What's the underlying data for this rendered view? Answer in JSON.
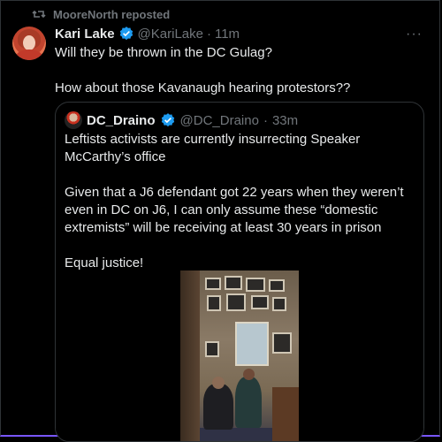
{
  "repost": {
    "label": "MooreNorth reposted"
  },
  "tweet": {
    "author_name": "Kari Lake",
    "handle": "@KariLake",
    "separator": "·",
    "time": "11m",
    "more": "···",
    "text_line1": "Will they be thrown in the DC Gulag?",
    "text_line2": "How about those Kavanaugh hearing protestors??"
  },
  "quote": {
    "author_name": "DC_Draino",
    "handle": "@DC_Draino",
    "separator": "·",
    "time": "33m",
    "p1": "Leftists activists are currently insurrecting Speaker McCarthy’s office",
    "p2": "Given that a J6 defendant got 22 years when they weren’t even in DC on J6, I can only assume these “domestic extremists” will be receiving at least 30 years in prison",
    "p3": "Equal justice!"
  },
  "icons": {
    "repost": "repost-icon",
    "verified": "verified-badge-icon",
    "more": "more-options-icon"
  },
  "colors": {
    "background": "#000000",
    "text": "#e7e9ea",
    "muted": "#71767b",
    "verified": "#1d9bf0",
    "border": "#2f3336",
    "accent": "#7856ff"
  }
}
